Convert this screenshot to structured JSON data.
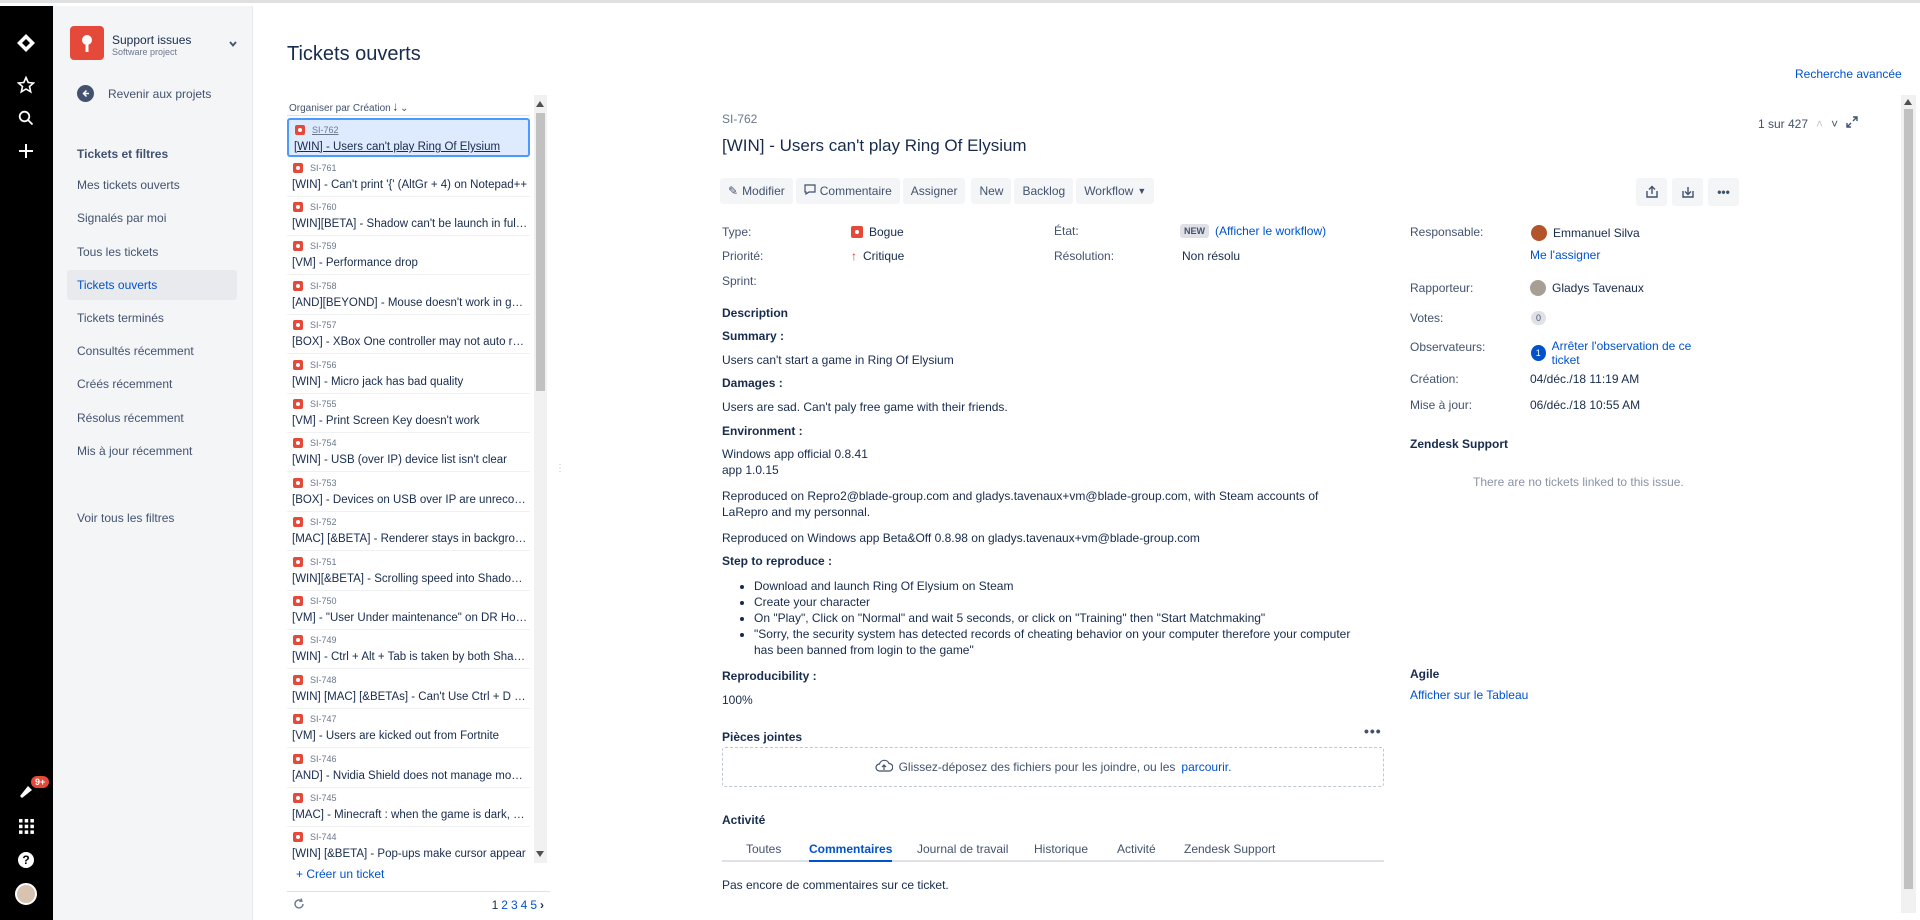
{
  "colors": {
    "accent": "#0052cc",
    "brand": "#e5493a",
    "nav_bg": "#000000",
    "sidebar_bg": "#f4f5f7"
  },
  "global_nav": {
    "icons": [
      "jira-logo-icon",
      "star-icon",
      "search-icon",
      "plus-icon",
      "notifications-icon",
      "app-switcher-icon",
      "help-icon",
      "profile-avatar"
    ],
    "notif_badge": "9+"
  },
  "sidebar": {
    "project_name": "Support issues",
    "project_type": "Software project",
    "back_label": "Revenir aux projets",
    "section_title": "Tickets et filtres",
    "items": [
      {
        "label": "Mes tickets ouverts"
      },
      {
        "label": "Signalés par moi"
      },
      {
        "label": "Tous les tickets"
      },
      {
        "label": "Tickets ouverts"
      },
      {
        "label": "Tickets terminés"
      },
      {
        "label": "Consultés récemment"
      },
      {
        "label": "Créés récemment"
      },
      {
        "label": "Résolus récemment"
      },
      {
        "label": "Mis à jour récemment"
      }
    ],
    "all_filters": "Voir tous les filtres"
  },
  "header": {
    "title": "Tickets ouverts",
    "advanced_search": "Recherche avancée"
  },
  "list": {
    "order_label": "Organiser par",
    "order_field": "Création",
    "items": [
      {
        "key": "SI-762",
        "summary": "[WIN] - Users can't play Ring Of Elysium"
      },
      {
        "key": "SI-761",
        "summary": "[WIN] - Can't print '{' (AltGr + 4) on Notepad++"
      },
      {
        "key": "SI-760",
        "summary": "[WIN][BETA] - Shadow can't be launch in fullscreen"
      },
      {
        "key": "SI-759",
        "summary": "[VM] - Performance drop"
      },
      {
        "key": "SI-758",
        "summary": "[AND][BEYOND] - Mouse doesn't work in game"
      },
      {
        "key": "SI-757",
        "summary": "[BOX] - XBox One controller may not auto reconnect"
      },
      {
        "key": "SI-756",
        "summary": "[WIN] - Micro jack has bad quality"
      },
      {
        "key": "SI-755",
        "summary": "[VM] - Print Screen Key doesn't work"
      },
      {
        "key": "SI-754",
        "summary": "[WIN] - USB (over IP) device list isn't clear"
      },
      {
        "key": "SI-753",
        "summary": "[BOX] - Devices on USB over IP are unrecognized"
      },
      {
        "key": "SI-752",
        "summary": "[MAC] [&BETA] - Renderer stays in background"
      },
      {
        "key": "SI-751",
        "summary": "[WIN][&BETA] - Scrolling speed into Shadow is slow"
      },
      {
        "key": "SI-750",
        "summary": "[VM] - \"User Under maintenance\" on DR Hosts"
      },
      {
        "key": "SI-749",
        "summary": "[WIN] - Ctrl + Alt + Tab is taken by both Shadow"
      },
      {
        "key": "SI-748",
        "summary": "[WIN] [MAC] [&BETAs] - Can't Use Ctrl + D in app"
      },
      {
        "key": "SI-747",
        "summary": "[VM] - Users are kicked out from Fortnite"
      },
      {
        "key": "SI-746",
        "summary": "[AND] - Nvidia Shield does not manage mouse"
      },
      {
        "key": "SI-745",
        "summary": "[MAC] - Minecraft : when the game is dark, colors"
      },
      {
        "key": "SI-744",
        "summary": "[WIN] [&BETA] - Pop-ups make cursor appear"
      }
    ],
    "create_label": "+ Créer un ticket",
    "pages": [
      "1",
      "2",
      "3",
      "4",
      "5"
    ]
  },
  "issue": {
    "key": "SI-762",
    "title": "[WIN] - Users can't play Ring Of Elysium",
    "counter": "1 sur 427",
    "toolbar": {
      "edit": "Modifier",
      "comment": "Commentaire",
      "assign": "Assigner",
      "new": "New",
      "backlog": "Backlog",
      "workflow": "Workflow"
    },
    "fields": {
      "type_label": "Type:",
      "type_value": "Bogue",
      "priority_label": "Priorité:",
      "priority_value": "Critique",
      "sprint_label": "Sprint:",
      "status_label": "État:",
      "status_value": "NEW",
      "status_link": "(Afficher le workflow)",
      "resolution_label": "Résolution:",
      "resolution_value": "Non résolu"
    },
    "description_title": "Description",
    "summary_title": "Summary :",
    "summary_text": "Users can't start a game in Ring Of Elysium",
    "damages_title": "Damages :",
    "damages_text": "Users are sad. Can't paly free game with their friends.",
    "env_title": "Environment :",
    "env_line1": "Windows app official 0.8.41",
    "env_line2": "app 1.0.15",
    "repro1": "Reproduced on Repro2@blade-group.com and gladys.tavenaux+vm@blade-group.com, with Steam accounts of LaRepro and my personnal.",
    "repro2": "Reproduced on Windows app Beta&Off 0.8.98 on gladys.tavenaux+vm@blade-group.com",
    "steps_title": "Step to reproduce :",
    "steps": [
      {
        "text": "Download and launch Ring Of Elysium on Steam"
      },
      {
        "text": "Create your character"
      },
      {
        "text": "On \"Play\", Click on \"Normal\" and wait 5 seconds, or click on \"Training\" then \"Start Matchmaking\""
      },
      {
        "text": "\"Sorry, the security system has detected records of cheating behavior on your computer therefore your computer has been banned from login to the game\""
      }
    ],
    "repro_title": "Reproducibility :",
    "repro_value": "100%",
    "attachments_title": "Pièces jointes",
    "drop_text": "Glissez-déposez des fichiers pour les joindre, ou les",
    "drop_link": "parcourir.",
    "activity_title": "Activité",
    "tabs": [
      {
        "label": "Toutes"
      },
      {
        "label": "Commentaires"
      },
      {
        "label": "Journal de travail"
      },
      {
        "label": "Historique"
      },
      {
        "label": "Activité"
      },
      {
        "label": "Zendesk Support"
      }
    ],
    "no_comments": "Pas encore de commentaires sur ce ticket."
  },
  "people": {
    "assignee_label": "Responsable:",
    "assignee_name": "Emmanuel Silva",
    "assign_me": "Me l'assigner",
    "reporter_label": "Rapporteur:",
    "reporter_name": "Gladys Tavenaux",
    "votes_label": "Votes:",
    "votes_value": "0",
    "watchers_label": "Observateurs:",
    "watchers_count": "1",
    "watch_link": "Arrêter l'observation de ce ticket",
    "created_label": "Création:",
    "created_value": "04/déc./18 11:19 AM",
    "updated_label": "Mise à jour:",
    "updated_value": "06/déc./18 10:55 AM",
    "zendesk_title": "Zendesk Support",
    "zendesk_empty": "There are no tickets linked to this issue.",
    "agile_title": "Agile",
    "agile_link": "Afficher sur le Tableau"
  }
}
